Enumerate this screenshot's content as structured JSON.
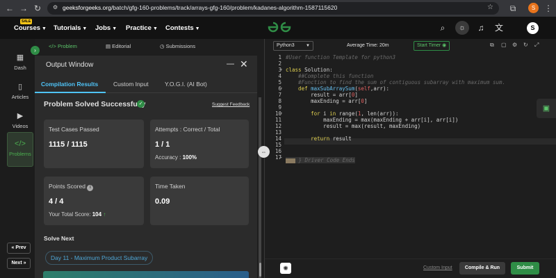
{
  "browser": {
    "url_host": "geeksforgeeks.org",
    "url_path": "/batch/gfg-160-problems/track/arrays-gfg-160/problem/kadanes-algorithm-1587115620",
    "profile_initial": "S"
  },
  "header": {
    "sale_badge": "SALE",
    "menu": [
      {
        "label": "Courses"
      },
      {
        "label": "Tutorials"
      },
      {
        "label": "Jobs"
      },
      {
        "label": "Practice"
      },
      {
        "label": "Contests"
      }
    ],
    "logo_text": "GG",
    "avatar_initial": "S"
  },
  "rail": {
    "items": [
      {
        "label": "Dash",
        "icon": "dashboard-icon"
      },
      {
        "label": "Articles",
        "icon": "book-icon"
      },
      {
        "label": "Videos",
        "icon": "video-icon"
      },
      {
        "label": "Problems",
        "icon": "code-icon"
      }
    ],
    "prev": "« Prev",
    "next": "Next »"
  },
  "panel_tabs": [
    {
      "label": "Problem"
    },
    {
      "label": "Editorial"
    },
    {
      "label": "Submissions"
    }
  ],
  "output": {
    "title": "Output Window",
    "tabs": [
      {
        "label": "Compilation Results"
      },
      {
        "label": "Custom Input"
      },
      {
        "label": "Y.O.G.I. (AI Bot)"
      }
    ],
    "status": "Problem Solved Successfully",
    "feedback": "Suggest Feedback",
    "cards": {
      "test_cases": {
        "label": "Test Cases Passed",
        "value": "1115 / 1115"
      },
      "attempts": {
        "label": "Attempts : Correct / Total",
        "value": "1 / 1",
        "sub_label": "Accuracy :",
        "sub_value": "100%"
      },
      "points": {
        "label": "Points Scored",
        "value": "4 / 4",
        "sub_label": "Your Total Score:",
        "sub_value": "104"
      },
      "time": {
        "label": "Time Taken",
        "value": "0.09"
      }
    },
    "solve_next": "Solve Next",
    "next_problem": "Day 11 - Maximum Product Subarray"
  },
  "editor": {
    "language": "Python3",
    "avg_time": "Average Time: 20m",
    "start_timer": "Start Timer",
    "line_numbers": [
      "1",
      "2",
      "3",
      "4",
      "5",
      "6",
      "7",
      "8",
      "9",
      "10",
      "11",
      "12",
      "13",
      "14",
      "15",
      "16",
      "17"
    ],
    "lines": {
      "l1": "#User function Template for python3",
      "l3a": "class",
      "l3b": " Solution:",
      "l4": "    ##Complete this function",
      "l5": "    #Function to find the sum of contiguous subarray with maximum sum.",
      "l6a": "    def ",
      "l6b": "maxSubArraySum",
      "l6c": "(",
      "l6d": "self",
      "l6e": ",arr):",
      "l7a": "        result = arr[",
      "l7b": "0",
      "l7c": "]",
      "l8a": "        maxEnding = arr[",
      "l8b": "0",
      "l8c": "]",
      "l10a": "        for",
      "l10b": " i ",
      "l10c": "in",
      "l10d": " range(",
      "l10e": "1",
      "l10f": ", len(arr)):",
      "l11": "            maxEnding = max(maxEnding + arr[i], arr[i])",
      "l12": "            result = max(result, maxEnding)",
      "l14a": "        return",
      "l14b": " result",
      "l17": " } Driver Code Ends"
    },
    "custom_input": "Custom Input",
    "compile_run": "Compile & Run",
    "submit": "Submit"
  }
}
